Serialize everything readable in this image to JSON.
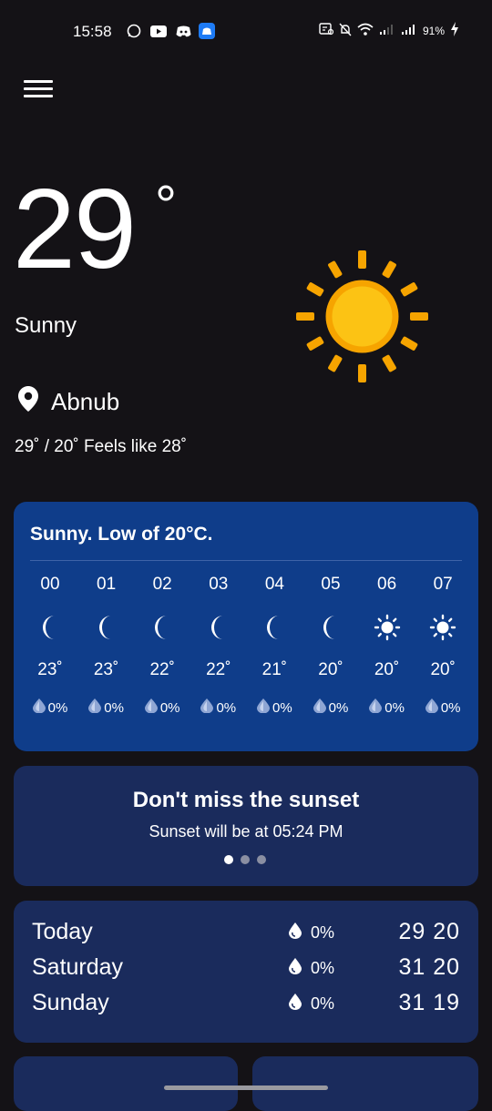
{
  "status_bar": {
    "time": "15:58",
    "battery": "91%",
    "left_icons": [
      "whatsapp-icon",
      "youtube-icon",
      "discord-icon",
      "app-icon"
    ],
    "right_icons": [
      "sim-icon",
      "mute-icon",
      "wifi-icon",
      "signal-icon",
      "signal-icon",
      "charging-icon"
    ]
  },
  "current": {
    "temperature": "29",
    "degree": "°",
    "condition": "Sunny",
    "location": "Abnub",
    "hilo_text": "29˚ / 20˚  Feels like 28˚"
  },
  "hourly": {
    "summary": "Sunny. Low of 20°C.",
    "hours": [
      {
        "hour": "00",
        "icon": "moon-icon",
        "temp": "23˚",
        "precip": "0%"
      },
      {
        "hour": "01",
        "icon": "moon-icon",
        "temp": "23˚",
        "precip": "0%"
      },
      {
        "hour": "02",
        "icon": "moon-icon",
        "temp": "22˚",
        "precip": "0%"
      },
      {
        "hour": "03",
        "icon": "moon-icon",
        "temp": "22˚",
        "precip": "0%"
      },
      {
        "hour": "04",
        "icon": "moon-icon",
        "temp": "21˚",
        "precip": "0%"
      },
      {
        "hour": "05",
        "icon": "moon-icon",
        "temp": "20˚",
        "precip": "0%"
      },
      {
        "hour": "06",
        "icon": "sun-icon",
        "temp": "20˚",
        "precip": "0%"
      },
      {
        "hour": "07",
        "icon": "sun-icon",
        "temp": "20˚",
        "precip": "0%"
      }
    ]
  },
  "sunset_card": {
    "title": "Don't miss the sunset",
    "subtitle": "Sunset will be at 05:24 PM",
    "pages": 3,
    "active_page": 0
  },
  "daily": [
    {
      "day": "Today",
      "precip": "0%",
      "hilo": "29 20"
    },
    {
      "day": "Saturday",
      "precip": "0%",
      "hilo": "31 20"
    },
    {
      "day": "Sunday",
      "precip": "0%",
      "hilo": "31 19"
    }
  ],
  "colors": {
    "background": "#141216",
    "hourly_card": "#0f3d8a",
    "secondary_card": "#1a2b5c",
    "sun": "#f6a400"
  }
}
